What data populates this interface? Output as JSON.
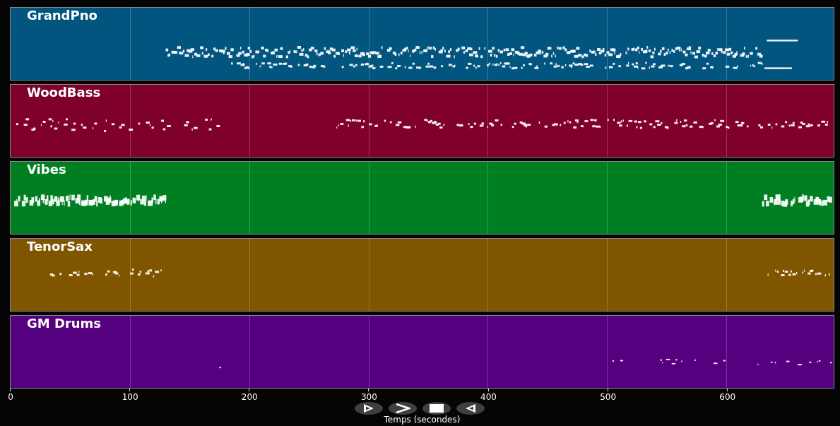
{
  "tracks": [
    {
      "name": "GrandPno",
      "color": "#02557f"
    },
    {
      "name": "WoodBass",
      "color": "#7f002a"
    },
    {
      "name": "Vibes",
      "color": "#007f22"
    },
    {
      "name": "TenorSax",
      "color": "#7f5500"
    },
    {
      "name": "GM Drums",
      "color": "#55007f"
    }
  ],
  "axis": {
    "ticks": [
      "0",
      "100",
      "200",
      "300",
      "400",
      "500",
      "600"
    ],
    "label": "Temps (secondes)"
  }
}
